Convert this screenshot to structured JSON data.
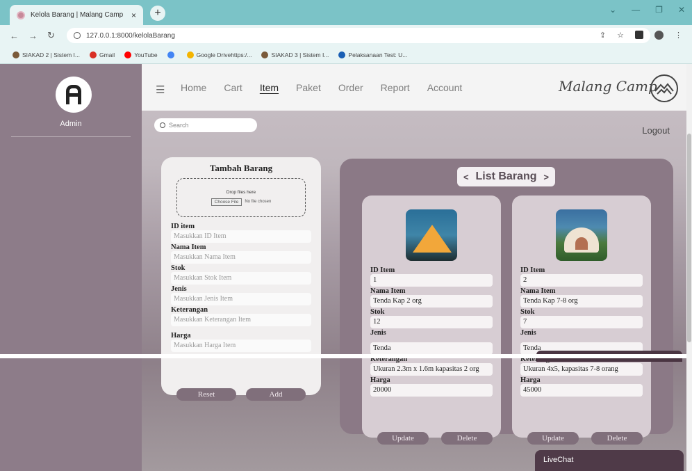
{
  "browser": {
    "tab_title": "Kelola Barang | Malang Camp",
    "tab_close": "×",
    "new_tab": "+",
    "url": "127.0.0.1:8000/kelolaBarang",
    "bookmarks": [
      {
        "label": "SIAKAD 2 | Sistem I...",
        "color": "#7a5a3a"
      },
      {
        "label": "Gmail",
        "color": "#d93025"
      },
      {
        "label": "YouTube",
        "color": "#ff0000"
      },
      {
        "label": "",
        "color": "#4285f4"
      },
      {
        "label": "Google Drivehttps:/...",
        "color": "#f4b400"
      },
      {
        "label": "SIAKAD 3 | Sistem I...",
        "color": "#7a5a3a"
      },
      {
        "label": "Pelaksanaan Test: U...",
        "color": "#1a5fb4"
      }
    ]
  },
  "sidebar": {
    "admin_label": "Admin"
  },
  "navbar": {
    "menu": [
      "Home",
      "Cart",
      "Item",
      "Paket",
      "Order",
      "Report",
      "Account"
    ],
    "active_item": "Item",
    "brand": "Malang Camp"
  },
  "toolbar": {
    "search_placeholder": "Search",
    "logout": "Logout"
  },
  "form": {
    "title": "Tambah Barang",
    "dropzone_text": "Drop files here",
    "choose_file": "Choose File",
    "no_file": "No file chosen",
    "fields": [
      {
        "label": "ID item",
        "placeholder": "Masukkan ID Item"
      },
      {
        "label": "Nama Item",
        "placeholder": "Masukkan Nama Item"
      },
      {
        "label": "Stok",
        "placeholder": "Masukkan Stok Item"
      },
      {
        "label": "Jenis",
        "placeholder": "Masukkan Jenis Item"
      },
      {
        "label": "Keterangan",
        "placeholder": "Masukkan Keterangan Item"
      },
      {
        "label": "Harga",
        "placeholder": "Masukkan Harga Item"
      }
    ],
    "reset": "Reset",
    "add": "Add"
  },
  "list": {
    "title": "List Barang",
    "prev": "<",
    "next": ">",
    "labels": {
      "id": "ID Item",
      "name": "Nama Item",
      "stock": "Stok",
      "type": "Jenis",
      "desc": "Keterangan",
      "price": "Harga"
    },
    "update": "Update",
    "delete": "Delete",
    "items": [
      {
        "id": "1",
        "name": "Tenda Kap 2 org",
        "stock": "12",
        "type": "Tenda",
        "desc": "Ukuran 2.3m x 1.6m kapasitas 2 org",
        "price": "20000"
      },
      {
        "id": "2",
        "name": "Tenda Kap 7-8 org",
        "stock": "7",
        "type": "Tenda",
        "desc": "Ukuran 4x5, kapasitas 7-8 orang",
        "price": "45000"
      }
    ]
  },
  "livechat": "LiveChat"
}
